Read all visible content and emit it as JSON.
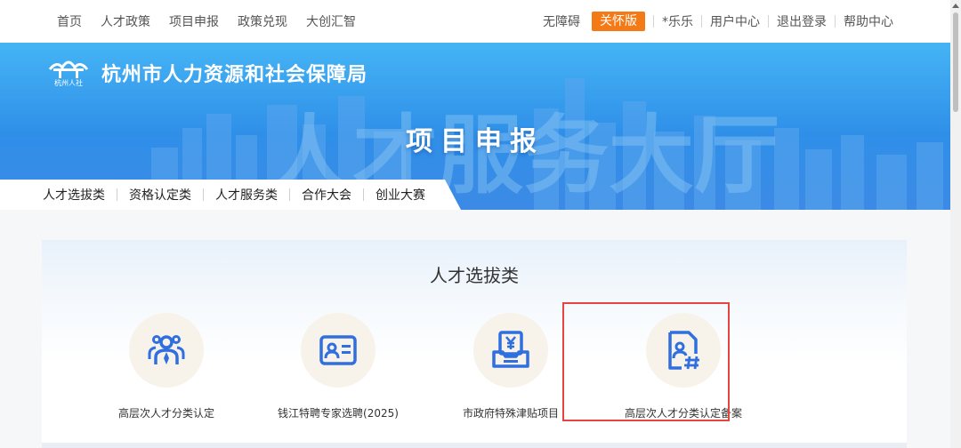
{
  "topnav": {
    "left": [
      "首页",
      "人才政策",
      "项目申报",
      "政策兑现",
      "大创汇智"
    ],
    "accessibility": "无障碍",
    "care_mode": "关怀版",
    "user": "*乐乐",
    "user_center": "用户中心",
    "logout": "退出登录",
    "help": "帮助中心"
  },
  "banner": {
    "logo_text": "杭州人社",
    "bureau_name": "杭州市人力资源和社会保障局",
    "page_title": "项目申报",
    "bg_text": "人才服务大厅"
  },
  "categories": [
    "人才选拔类",
    "资格认定类",
    "人才服务类",
    "合作大会",
    "创业大赛"
  ],
  "section": {
    "title": "人才选拔类",
    "cards": [
      {
        "label": "高层次人才分类认定",
        "icon": "talent-group-icon"
      },
      {
        "label": "钱江特聘专家选聘(2025)",
        "icon": "id-card-icon"
      },
      {
        "label": "市政府特殊津贴项目",
        "icon": "allowance-tray-icon"
      },
      {
        "label": "高层次人才分类认定备案",
        "icon": "document-hash-icon"
      }
    ]
  },
  "colors": {
    "accent_orange": "#f47a16",
    "icon_blue": "#2f6fe0",
    "highlight_red": "#e5443f"
  }
}
